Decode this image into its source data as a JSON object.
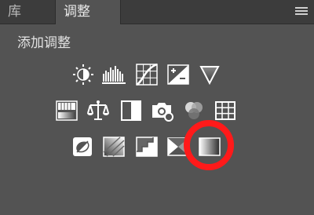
{
  "tabs": [
    {
      "label": "库",
      "active": false
    },
    {
      "label": "调整",
      "active": true
    }
  ],
  "heading": "添加调整",
  "icons": {
    "brightness_contrast": "brightness-contrast-icon",
    "levels": "levels-icon",
    "curves": "curves-icon",
    "exposure": "exposure-icon",
    "vibrance": "vibrance-icon",
    "hue_saturation": "hue-saturation-icon",
    "color_balance": "color-balance-icon",
    "black_white": "black-white-icon",
    "photo_filter": "photo-filter-icon",
    "channel_mixer": "channel-mixer-icon",
    "color_lookup": "color-lookup-icon",
    "invert": "invert-icon",
    "posterize": "posterize-icon",
    "threshold": "threshold-icon",
    "selective_color": "selective-color-icon",
    "gradient_map": "gradient-map-icon"
  },
  "colors": {
    "panel_bg": "#535353",
    "tab_bar_bg": "#3c3c3c",
    "icon_fg": "#ffffff",
    "annotation": "#ff1a1a"
  }
}
